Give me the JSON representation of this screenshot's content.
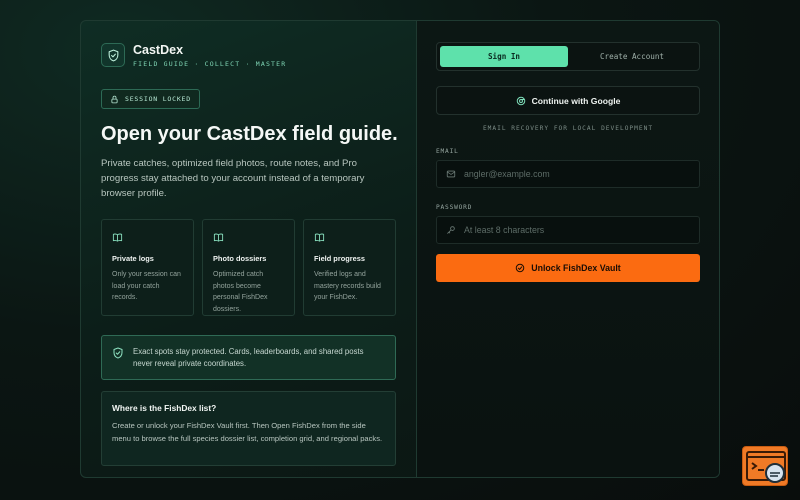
{
  "brand": {
    "name": "CastDex",
    "tagline": "FIELD GUIDE · COLLECT · MASTER"
  },
  "badge": {
    "label": "SESSION LOCKED"
  },
  "hero": {
    "title": "Open your CastDex field guide.",
    "subtitle": "Private catches, optimized field photos, route notes, and Pro progress stay attached to your account instead of a temporary browser profile."
  },
  "features": [
    {
      "title": "Private logs",
      "text": "Only your session can load your catch records.",
      "icon": "book-icon"
    },
    {
      "title": "Photo dossiers",
      "text": "Optimized catch photos become personal FishDex dossiers.",
      "icon": "book-icon"
    },
    {
      "title": "Field progress",
      "text": "Verified logs and mastery records build your FishDex.",
      "icon": "book-icon"
    }
  ],
  "notice": {
    "text": "Exact spots stay protected. Cards, leaderboards, and shared posts never reveal private coordinates."
  },
  "info": {
    "title": "Where is the FishDex list?",
    "text": "Create or unlock your FishDex Vault first. Then Open FishDex from the side menu to browse the full species dossier list, completion grid, and regional packs."
  },
  "auth": {
    "tabs": [
      {
        "label": "Sign In",
        "active": true
      },
      {
        "label": "Create Account",
        "active": false
      }
    ],
    "google_label": "Continue with Google",
    "hint": "EMAIL RECOVERY FOR LOCAL DEVELOPMENT",
    "email": {
      "label": "EMAIL",
      "placeholder": "angler@example.com",
      "value": ""
    },
    "password": {
      "label": "PASSWORD",
      "placeholder": "At least 8 characters",
      "value": ""
    },
    "submit_label": "Unlock FishDex Vault"
  },
  "colors": {
    "accent_green": "#5ee1ab",
    "accent_orange": "#fb6b11",
    "background": "#0b1613"
  }
}
